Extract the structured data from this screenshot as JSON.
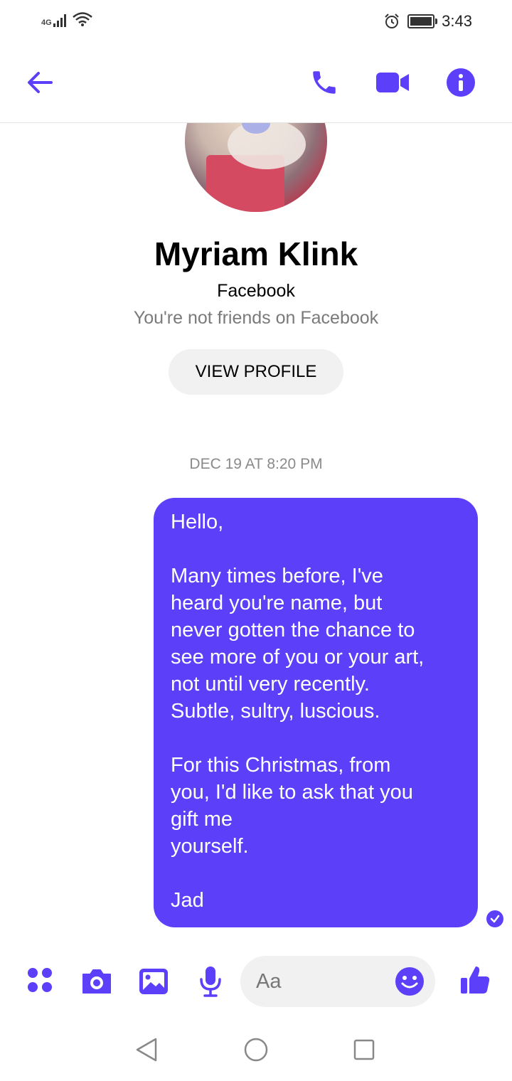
{
  "status": {
    "network": "4G",
    "time": "3:43"
  },
  "header": {
    "icons": [
      "back-arrow-icon",
      "phone-icon",
      "video-camera-icon",
      "info-icon"
    ]
  },
  "profile": {
    "name": "Myriam Klink",
    "source": "Facebook",
    "relationship": "You're not friends on Facebook",
    "view_profile_label": "VIEW PROFILE"
  },
  "conversation": {
    "timestamp": "DEC 19 AT 8:20 PM",
    "message": {
      "lines": [
        "Hello,",
        "",
        "Many times before, I've",
        "heard you're name, but",
        "never gotten the chance to",
        "see more of you or your art,",
        "not until very recently.",
        "Subtle, sultry, luscious.",
        "",
        "For this Christmas, from",
        "you, I'd like to ask that you",
        "gift me",
        "yourself.",
        "",
        "Jad"
      ],
      "status_icon": "seen-check-icon"
    }
  },
  "composer": {
    "placeholder": "Aa",
    "icons": [
      "apps-grid-icon",
      "camera-icon",
      "gallery-icon",
      "microphone-icon",
      "emoji-icon",
      "thumbs-up-icon"
    ]
  },
  "navbar": {
    "icons": [
      "nav-back-icon",
      "nav-home-icon",
      "nav-recents-icon"
    ]
  },
  "colors": {
    "accent": "#5b3ff9",
    "bubble_text": "#ffffff",
    "muted_text": "#7a7a7a"
  }
}
